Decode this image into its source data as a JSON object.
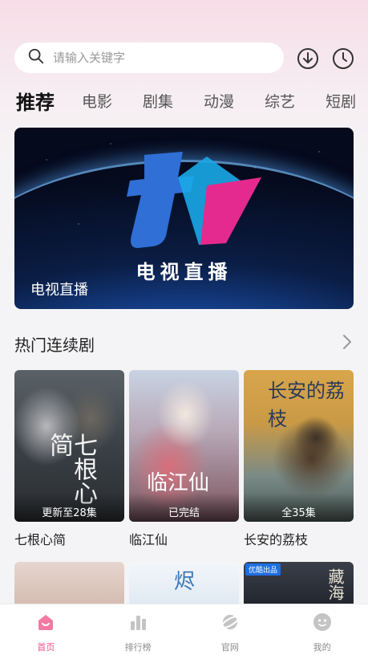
{
  "search": {
    "placeholder": "请输入关键字"
  },
  "tabs": [
    {
      "label": "推荐",
      "active": true
    },
    {
      "label": "电影"
    },
    {
      "label": "剧集"
    },
    {
      "label": "动漫"
    },
    {
      "label": "综艺"
    },
    {
      "label": "短剧"
    }
  ],
  "banner": {
    "logo_text": "电视直播",
    "caption": "电视直播"
  },
  "section": {
    "title": "热门连续剧"
  },
  "cards": [
    {
      "title": "七根心简",
      "badge": "更新至28集",
      "poster_text": "七根心简"
    },
    {
      "title": "临江仙",
      "badge": "已完结",
      "poster_text": "临江仙"
    },
    {
      "title": "长安的荔枝",
      "badge": "全35集",
      "poster_text": "长安的荔枝"
    }
  ],
  "cards_row2": [
    {
      "poster_text": ""
    },
    {
      "poster_text": "烬"
    },
    {
      "tag": "优酷出品",
      "poster_text": "藏海"
    }
  ],
  "nav": [
    {
      "label": "首页",
      "icon": "home-icon",
      "active": true
    },
    {
      "label": "排行榜",
      "icon": "chart-icon"
    },
    {
      "label": "官网",
      "icon": "planet-icon"
    },
    {
      "label": "我的",
      "icon": "profile-icon"
    }
  ],
  "colors": {
    "accent": "#f0508a",
    "inactive": "#bdbdbd"
  }
}
